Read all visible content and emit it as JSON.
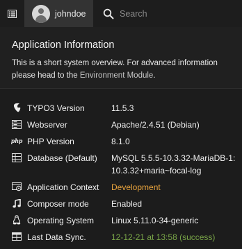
{
  "topbar": {
    "menu_icon": "list-icon",
    "username": "johndoe",
    "search": {
      "placeholder": "Search",
      "value": ""
    }
  },
  "panel": {
    "title": "Application Information",
    "description_prefix": "This is a short system overview. For advanced information please head to the ",
    "description_link": "Environment Module",
    "description_suffix": "."
  },
  "info_rows": [
    {
      "icon": "typo3-icon",
      "label": "TYPO3 Version",
      "value": "11.5.3",
      "status": "normal"
    },
    {
      "icon": "server-icon",
      "label": "Webserver",
      "value": "Apache/2.4.51 (Debian)",
      "status": "normal"
    },
    {
      "icon": "php-icon",
      "icon_text": "php",
      "label": "PHP Version",
      "value": "8.1.0",
      "status": "normal"
    },
    {
      "icon": "database-icon",
      "label": "Database (Default)",
      "value": "MySQL 5.5.5-10.3.32-MariaDB-1:10.3.32+maria~focal-log",
      "status": "normal"
    },
    {
      "icon": "context-icon",
      "label": "Application Context",
      "value": "Development",
      "status": "warning"
    },
    {
      "icon": "music-note-icon",
      "label": "Composer mode",
      "value": "Enabled",
      "status": "normal"
    },
    {
      "icon": "linux-icon",
      "label": "Operating System",
      "value": "Linux 5.11.0-34-generic",
      "status": "normal"
    },
    {
      "icon": "table-icon",
      "label": "Last Data Sync.",
      "value": "12-12-21 at 13:58 (success)",
      "status": "success"
    }
  ],
  "colors": {
    "background": "#1c1c1c",
    "topbar_user_bg": "#333333",
    "warning": "#e8a33d",
    "success": "#79a548"
  }
}
